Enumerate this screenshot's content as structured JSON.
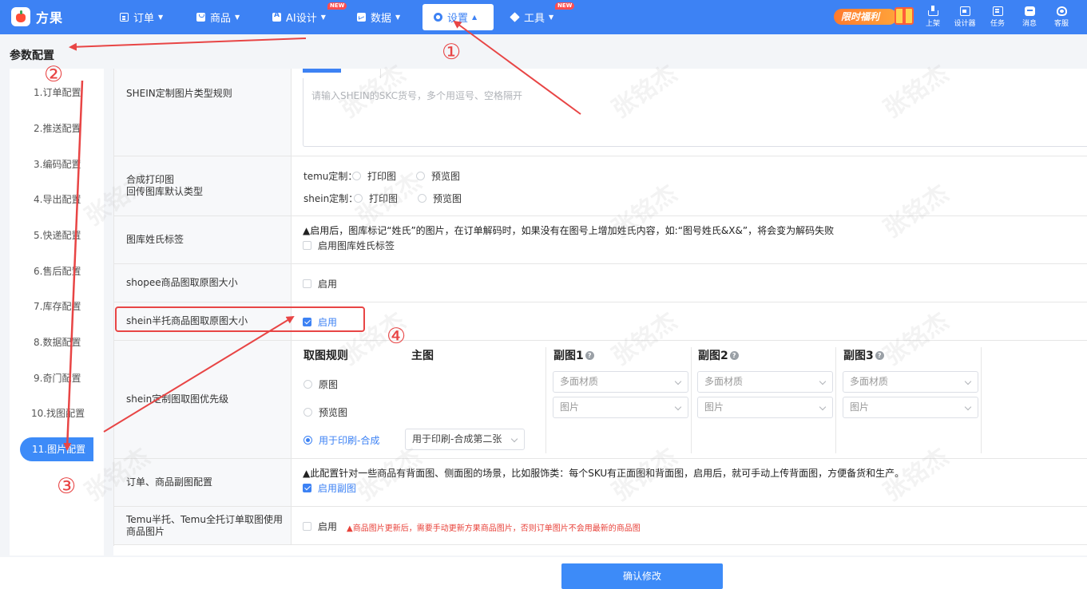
{
  "app": {
    "logo_text": "方果"
  },
  "nav": {
    "order": "订单",
    "product": "商品",
    "ai_design": "AI设计",
    "data": "数据",
    "settings": "设置",
    "tools": "工具",
    "new_badge": "NEW"
  },
  "promo": {
    "label": "限时福利"
  },
  "tools": {
    "upload": "上架",
    "designer": "设计器",
    "tasks": "任务",
    "messages": "消息",
    "service": "客服"
  },
  "page": {
    "title": "参数配置"
  },
  "sidebar": {
    "items": [
      "1.订单配置",
      "2.推送配置",
      "3.编码配置",
      "4.导出配置",
      "5.快递配置",
      "6.售后配置",
      "7.库存配置",
      "8.数据配置",
      "9.奇门配置",
      "10.找图配置",
      "11.图片配置"
    ],
    "active_index": 10
  },
  "rows": {
    "shein_custom_rule": {
      "label": "SHEIN定制图片类型规则",
      "placeholder": "请输入SHEIN的SKC货号，多个用逗号、空格隔开"
    },
    "synth_print": {
      "label_line1": "合成打印图",
      "label_line2": "回传图库默认类型",
      "temu_label": "temu定制：",
      "shein_label": "shein定制：",
      "opt_print": "打印图",
      "opt_preview": "预览图"
    },
    "surname_tag": {
      "label": "图库姓氏标签",
      "warning": "▲启用后，图库标记“姓氏”的图片，在订单解码时，如果没有在图号上增加姓氏内容，如:“图号姓氏&X&”，将会变为解码失败",
      "checkbox": "启用图库姓氏标签",
      "checked": false
    },
    "shopee_original": {
      "label": "shopee商品图取原图大小",
      "checkbox": "启用",
      "checked": false
    },
    "shein_semi_original": {
      "label": "shein半托商品图取原图大小",
      "checkbox": "启用",
      "checked": true
    },
    "shein_priority": {
      "label": "shein定制图取图优先级",
      "col_rule": "取图规则",
      "col_main": "主图",
      "col_sub1": "副图1",
      "col_sub2": "副图2",
      "col_sub3": "副图3",
      "opt_original": "原图",
      "opt_preview": "预览图",
      "opt_print_synth": "用于印刷-合成",
      "main_select": "用于印刷-合成第二张",
      "sub_material_placeholder": "多面材质",
      "sub_image_placeholder": "图片"
    },
    "sub_image_config": {
      "label": "订单、商品副图配置",
      "warning": "▲此配置针对一些商品有背面图、侧面图的场景，比如服饰类：每个SKU有正面图和背面图，启用后，就可手动上传背面图，方便备货和生产。",
      "checkbox": "启用副图",
      "checked": true
    },
    "temu_product_image": {
      "label": "Temu半托、Temu全托订单取图使用商品图片",
      "checkbox": "启用",
      "warning": "▲商品图片更新后，需要手动更新方果商品图片，否则订单图片不会用最新的商品图",
      "checked": false
    }
  },
  "footer": {
    "confirm": "确认修改"
  },
  "watermark": {
    "text": "张铭杰"
  },
  "annotations": {
    "n1": "①",
    "n2": "②",
    "n3": "③",
    "n4": "④"
  },
  "colors": {
    "primary": "#3d82f4",
    "annotation": "#e84545",
    "warning_red": "#e8423a"
  }
}
